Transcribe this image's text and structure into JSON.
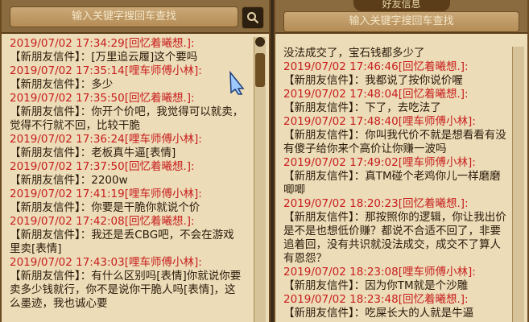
{
  "left": {
    "search_placeholder": "输入关键字搜回车查找",
    "messages": [
      {
        "head": "2019/07/02 17:34:29[回忆着曦想.]:",
        "body": "【新朋友信件】：[万里追云履]这个要吗"
      },
      {
        "head": "2019/07/02 17:35:14[哩车师傅小林]:",
        "body": "【新朋友信件】：多少"
      },
      {
        "head": "2019/07/02 17:35:50[回忆着曦想.]:",
        "body": "【新朋友信件】：你开个价吧，我觉得可以就卖，觉得不行就不回，比较干脆"
      },
      {
        "head": "2019/07/02 17:36:24[哩车师傅小林]:",
        "body": "【新朋友信件】：老板真牛逼[表情]"
      },
      {
        "head": "2019/07/02 17:37:50[回忆着曦想.]:",
        "body": "【新朋友信件】：2200w"
      },
      {
        "head": "2019/07/02 17:41:19[哩车师傅小林]:",
        "body": "【新朋友信件】：你要是干脆你就说个价"
      },
      {
        "head": "2019/07/02 17:42:08[回忆着曦想.]:",
        "body": "【新朋友信件】：我还是丢CBG吧，不会在游戏里卖[表情]"
      },
      {
        "head": "2019/07/02 17:43:03[哩车师傅小林]:",
        "body": "【新朋友信件】：有什么区别吗[表情]你就说你要卖多少钱就行，你不是说你干脆人吗[表情]，这么墨迹，我也诚心要"
      }
    ]
  },
  "right": {
    "search_placeholder": "输入关键字搜回车查找",
    "tab_label": "好友信息",
    "messages": [
      {
        "head": "",
        "body": "没法成交了，宝石钱都多少了"
      },
      {
        "head": "2019/07/02 17:46:46[回忆着曦想.]:",
        "body": "【新朋友信件】：我都说了按你说价喔"
      },
      {
        "head": "2019/07/02 17:48:04[回忆着曦想.]:",
        "body": "【新朋友信件】：下了，去吃法了"
      },
      {
        "head": "2019/07/02 17:48:40[哩车师傅小林]:",
        "body": "【新朋友信件】：你叫我代价不就是想看看有没有傻子给你来个高价让你赚一波吗"
      },
      {
        "head": "2019/07/02 17:49:02[哩车师傅小林]:",
        "body": "【新朋友信件】：真TM碰个老鸡你儿一样磨磨唧唧"
      },
      {
        "head": "2019/07/02 18:20:23[回忆着曦想.]:",
        "body": "【新朋友信件】：那按照你的逻辑，你让我出价是不是也想低价赚？都说不合适不回了，非要追着回，没有共识就没法成交，成交不了算人有恩怨？"
      },
      {
        "head": "2019/07/02 18:23:08[哩车师傅小林]:",
        "body": "【新朋友信件】：因为你TM就是个沙雕"
      },
      {
        "head": "2019/07/02 18:23:48[回忆着曦想.]:",
        "body": "【新朋友信件】：吃屎长大的人就是牛逼"
      }
    ]
  },
  "colors": {
    "timestamp": "#c81e1e",
    "text": "#2a1a0a",
    "panel": "#ecdcb8"
  }
}
